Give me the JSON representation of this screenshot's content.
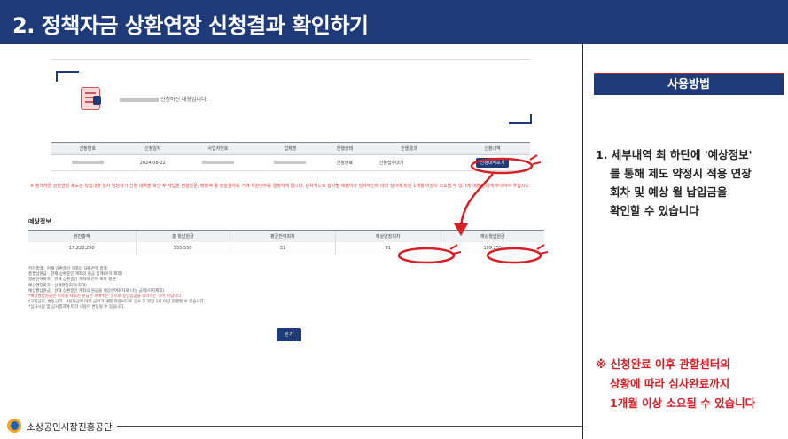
{
  "banner": {
    "title": "2. 정책자금 상환연장 신청결과 확인하기"
  },
  "screenshot": {
    "inquiry_text": "신청하신 내용입니다.",
    "app_table": {
      "headers": [
        "신청번호",
        "신청일자",
        "사업자번호",
        "업체명",
        "진행상태",
        "진행결과",
        "신청내역"
      ],
      "row": {
        "date": "2024-08-22",
        "status": "신청완료",
        "result": "신청접수대기",
        "detail_button": "신청내역보기"
      }
    },
    "notice": "※ 정책자금 상환연장 제도는 직접대출 심사 담당자가 신청 내역을 확인 후 사업장 현장방문, 배출액 등 정밀심사를 거쳐 지원여부를 결정하게 됩니다. 순차적으로 심사될 예정이나 심사부진에 따라 심사에 최장 1개월 이상이 소요될 수 있기에 대출 관리에 주의하여 주십시오",
    "estimate": {
      "title": "예상정보",
      "headers": [
        "현잔총액",
        "총 월납원금",
        "평균잔여회차",
        "예상연장회차",
        "예상월납원금"
      ],
      "values": [
        "17,222,250",
        "555,550",
        "31",
        "91",
        "189,255"
      ]
    },
    "definitions": [
      "현잔총액 : 현재 상환중인 계좌의 대출잔액 총액",
      "총월납원금 : 현재 상환중인 계좌의 원금 합계(이자 제외)",
      "평균잔여회차 : 현재 상환중인 계좌의 잔여 회차 평균",
      "예상연장회차 : 상환연장회차(최대)",
      "예상월납원금 : 현재 상환중인 계좌의 원금을 예상잔여회차로 나눈 금액(이자제외)"
    ],
    "definitions_red": "*예상월납원금은 이자를 제외한 원금만 보여주는 것으로 실납입금을 의미하는 것이 아닙니다.",
    "definitions_tail": [
      "*고정금리, 변동금리, 사용자금에 따라 금리가 개별 적용되므로 심사 후 약정 2회 이상 진행할 수 있습니다.",
      "*심사시점 및 심사결과에 따라 내용이 변동될 수 있습니다."
    ],
    "close_button": "닫기"
  },
  "right_panel": {
    "header": "사용방법",
    "instruction_lines": [
      "1. 세부내역 최 하단에 '예상정보'",
      "를 통해 제도 약정시 적용 연장",
      "회차 및 예상 월 납입금을",
      "확인할 수 있습니다"
    ],
    "note_lines": [
      "※ 신청완료 이후 관할센터의",
      "상황에 따라 심사완료까지",
      "1개월 이상 소요될 수 있습니다"
    ]
  },
  "footer": {
    "org_name": "소상공인시장진흥공단"
  },
  "colors": {
    "brand_navy": "#1f3a78",
    "highlight_red": "#d61f26",
    "divider": "#2c2c2c"
  },
  "icons": {
    "document": "document-icon",
    "logo": "semas-logo-icon"
  }
}
